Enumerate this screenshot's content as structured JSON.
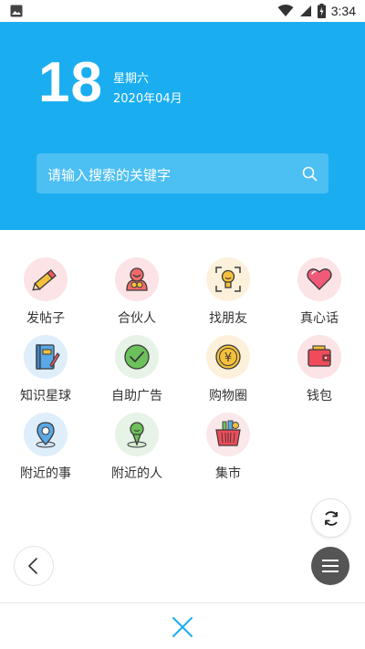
{
  "status_bar": {
    "time": "3:34",
    "icons": [
      "image-icon",
      "wifi-icon",
      "signal-icon",
      "battery-charging-icon"
    ]
  },
  "header": {
    "day": "18",
    "weekday": "星期六",
    "year_month": "2020年04月",
    "background_color": "#1aaef0"
  },
  "search": {
    "placeholder": "请输入搜索的关键字",
    "icon": "search-icon"
  },
  "grid": {
    "items": [
      {
        "label": "发帖子",
        "icon": "pencil-icon"
      },
      {
        "label": "合伙人",
        "icon": "partner-icon"
      },
      {
        "label": "找朋友",
        "icon": "find-friend-icon"
      },
      {
        "label": "真心话",
        "icon": "heart-icon"
      },
      {
        "label": "知识星球",
        "icon": "notebook-icon"
      },
      {
        "label": "自助广告",
        "icon": "check-icon"
      },
      {
        "label": "购物圈",
        "icon": "yen-coin-icon"
      },
      {
        "label": "钱包",
        "icon": "wallet-icon"
      },
      {
        "label": "附近的事",
        "icon": "location-pin-icon"
      },
      {
        "label": "附近的人",
        "icon": "nearby-person-icon"
      },
      {
        "label": "集市",
        "icon": "basket-icon"
      }
    ]
  },
  "controls": {
    "refresh": "refresh-icon",
    "back": "chevron-left-icon",
    "menu": "hamburger-menu-icon",
    "close": "close-icon",
    "accent_color": "#1aaef0"
  }
}
